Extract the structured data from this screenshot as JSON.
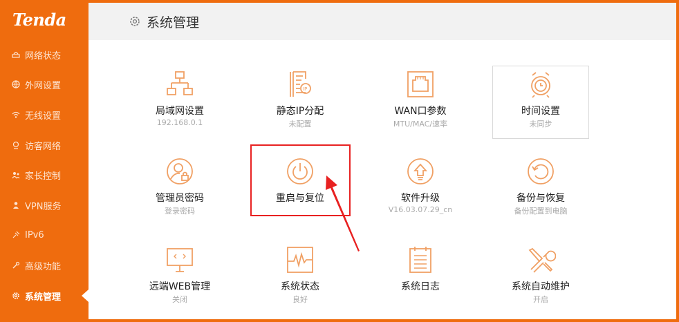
{
  "brand": {
    "logo_text": "Tenda",
    "accent_color": "#ef6c0e",
    "icon_color": "#f0a064"
  },
  "sidebar": {
    "items": [
      {
        "label": "网络状态",
        "icon": "router-icon",
        "active": false
      },
      {
        "label": "外网设置",
        "icon": "globe-icon",
        "active": false
      },
      {
        "label": "无线设置",
        "icon": "wifi-icon",
        "active": false
      },
      {
        "label": "访客网络",
        "icon": "guest-icon",
        "active": false
      },
      {
        "label": "家长控制",
        "icon": "parental-icon",
        "active": false
      },
      {
        "label": "VPN服务",
        "icon": "vpn-icon",
        "active": false
      },
      {
        "label": "IPv6",
        "icon": "ipv6-icon",
        "active": false
      },
      {
        "label": "高级功能",
        "icon": "tools-icon",
        "active": false
      },
      {
        "label": "系统管理",
        "icon": "gear-icon",
        "active": true
      }
    ]
  },
  "header": {
    "title": "系统管理",
    "icon": "gear-icon"
  },
  "tiles": [
    {
      "label": "局域网设置",
      "sub": "192.168.0.1",
      "icon": "lan-icon"
    },
    {
      "label": "静态IP分配",
      "sub": "未配置",
      "icon": "static-ip-icon"
    },
    {
      "label": "WAN口参数",
      "sub": "MTU/MAC/速率",
      "icon": "wan-port-icon"
    },
    {
      "label": "时间设置",
      "sub": "未同步",
      "icon": "clock-icon"
    },
    {
      "label": "管理员密码",
      "sub": "登录密码",
      "icon": "admin-password-icon"
    },
    {
      "label": "重启与复位",
      "sub": "",
      "icon": "power-icon"
    },
    {
      "label": "软件升级",
      "sub": "V16.03.07.29_cn",
      "icon": "upgrade-icon"
    },
    {
      "label": "备份与恢复",
      "sub": "备份配置到电脑",
      "icon": "backup-restore-icon"
    },
    {
      "label": "远端WEB管理",
      "sub": "关闭",
      "icon": "remote-web-icon"
    },
    {
      "label": "系统状态",
      "sub": "良好",
      "icon": "system-status-icon"
    },
    {
      "label": "系统日志",
      "sub": "",
      "icon": "system-log-icon"
    },
    {
      "label": "系统自动维护",
      "sub": "开启",
      "icon": "maintenance-icon"
    }
  ]
}
